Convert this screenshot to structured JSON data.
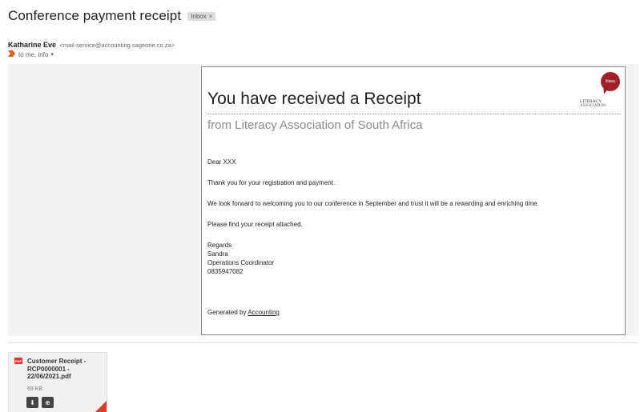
{
  "email": {
    "subject": "Conference payment receipt",
    "label": "Inbox",
    "label_close": "×",
    "sender_name": "Katharine Eve",
    "sender_email": "<mail-service@accounting.sageone.co.za>",
    "recipients": "to me, info",
    "caret": "▾"
  },
  "receipt": {
    "title": "You have received a Receipt",
    "subtitle": "from Literacy Association of South Africa",
    "logo_circle": "litasa",
    "logo_line1": "LITERACY",
    "logo_line2": "ASSOCIATION",
    "greeting": "Dear XXX",
    "para1": "Thank you for your registration and payment.",
    "para2": "We look forward to welcoming you to our conference in September and trust it will be a rewarding and enriching time.",
    "para3": "Please find your receipt attached.",
    "sign_regards": "Regards",
    "sign_name": "Sandra",
    "sign_role": "Operations Coordinator",
    "sign_phone": "0835947082",
    "generated_prefix": "Generated by",
    "generated_link": "Accounting"
  },
  "attachment": {
    "type_badge": "PDF",
    "name": "Customer Receipt - RCP0000001 - 22/06/2021.pdf",
    "size": "69 KB",
    "download_glyph": "⬇",
    "drive_glyph": "⊕"
  },
  "colors": {
    "brand_red": "#a11f2b",
    "pdf_red": "#db3a2f"
  }
}
